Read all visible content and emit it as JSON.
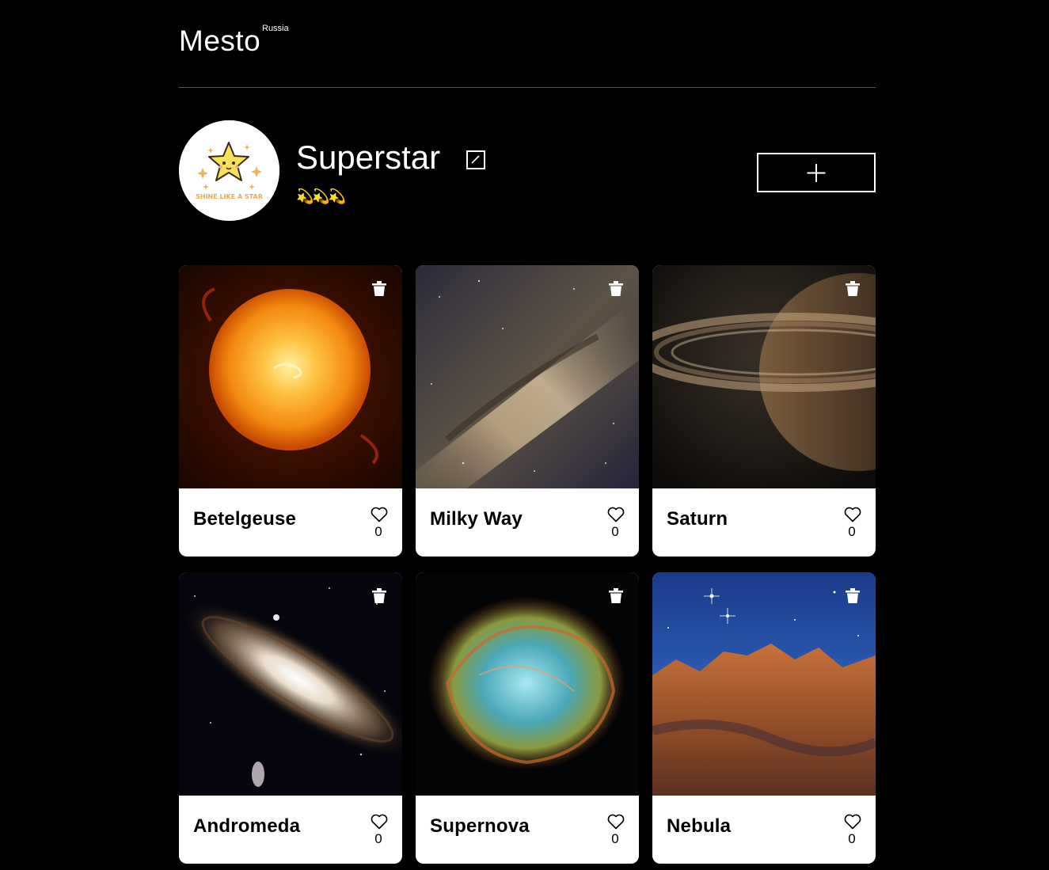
{
  "header": {
    "logo": "Mesto",
    "logo_sup": "Russia"
  },
  "profile": {
    "avatar_caption": "SHINE LIKE A STAR",
    "name": "Superstar",
    "about": "💫💫💫",
    "edit_icon": "pencil-edit-icon",
    "add_icon": "plus-icon"
  },
  "cards": [
    {
      "title": "Betelgeuse",
      "likes": "0",
      "image": "sun"
    },
    {
      "title": "Milky Way",
      "likes": "0",
      "image": "milkyway"
    },
    {
      "title": "Saturn",
      "likes": "0",
      "image": "saturn"
    },
    {
      "title": "Andromeda",
      "likes": "0",
      "image": "andromeda"
    },
    {
      "title": "Supernova",
      "likes": "0",
      "image": "supernova"
    },
    {
      "title": "Nebula",
      "likes": "0",
      "image": "nebula"
    }
  ],
  "colors": {
    "background": "#000000",
    "card": "#ffffff",
    "divider": "#545454"
  }
}
